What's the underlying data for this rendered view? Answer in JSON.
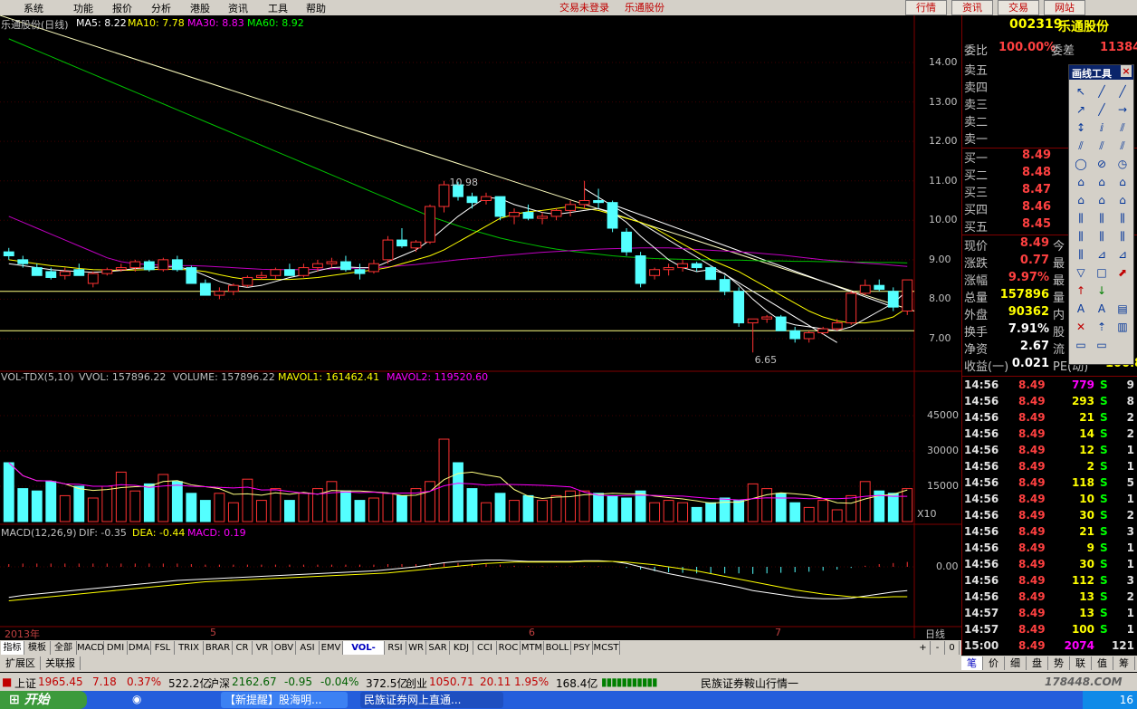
{
  "menu": [
    "系统",
    "功能",
    "报价",
    "分析",
    "港股",
    "资讯",
    "工具",
    "帮助"
  ],
  "menu_status": "交易未登录",
  "menu_stock": "乐通股份",
  "top_buttons": [
    "行情",
    "资讯",
    "交易",
    "网站"
  ],
  "stock": {
    "code": "002319",
    "name": "乐通股份"
  },
  "main_chart": {
    "title": "乐通股份(日线)",
    "ma_labels": [
      {
        "text": "MA5: 8.22",
        "color": "#ffffff"
      },
      {
        "text": "MA10: 7.78",
        "color": "#ffff00"
      },
      {
        "text": "MA30: 8.83",
        "color": "#ff00ff"
      },
      {
        "text": "MA60: 8.92",
        "color": "#00ff00"
      }
    ],
    "y_ticks": [
      "14.00",
      "13.00",
      "12.00",
      "11.00",
      "10.00",
      "9.00",
      "8.00",
      "7.00"
    ],
    "annotations": [
      "10.98",
      "6.65"
    ]
  },
  "vol_chart": {
    "labels": [
      {
        "text": "VOL-TDX(5,10)",
        "color": "#c0c0c0"
      },
      {
        "text": "VVOL: 157896.22",
        "color": "#c0c0c0"
      },
      {
        "text": "VOLUME: 157896.22",
        "color": "#c0c0c0"
      },
      {
        "text": "MAVOL1: 161462.41",
        "color": "#ffff00"
      },
      {
        "text": "MAVOL2: 119520.60",
        "color": "#ff00ff"
      }
    ],
    "y_ticks": [
      "45000",
      "30000",
      "15000"
    ],
    "unit_tag": "X10"
  },
  "macd_chart": {
    "labels": [
      {
        "text": "MACD(12,26,9)",
        "color": "#c0c0c0"
      },
      {
        "text": "DIF: -0.35",
        "color": "#c0c0c0"
      },
      {
        "text": "DEA: -0.44",
        "color": "#ffff00"
      },
      {
        "text": "MACD: 0.19",
        "color": "#ff00ff"
      }
    ],
    "y_tick": "0.00"
  },
  "x_axis": [
    "2013年",
    "5",
    "6",
    "7"
  ],
  "period": "日线",
  "chart_data": {
    "type": "candlestick",
    "candles": [
      [
        9.2,
        9.3,
        9.0,
        9.1
      ],
      [
        9.0,
        9.1,
        8.8,
        8.9
      ],
      [
        8.8,
        8.9,
        8.6,
        8.6
      ],
      [
        8.7,
        8.8,
        8.5,
        8.55
      ],
      [
        8.6,
        8.8,
        8.5,
        8.7
      ],
      [
        8.75,
        8.9,
        8.6,
        8.6
      ],
      [
        8.4,
        8.7,
        8.3,
        8.65
      ],
      [
        8.65,
        8.8,
        8.6,
        8.75
      ],
      [
        8.75,
        8.9,
        8.7,
        8.8
      ],
      [
        8.8,
        9.0,
        8.7,
        8.95
      ],
      [
        8.95,
        9.0,
        8.7,
        8.75
      ],
      [
        8.75,
        9.05,
        8.7,
        9.0
      ],
      [
        9.0,
        9.1,
        8.7,
        8.75
      ],
      [
        8.8,
        8.85,
        8.4,
        8.4
      ],
      [
        8.4,
        8.5,
        8.1,
        8.1
      ],
      [
        8.1,
        8.3,
        8.0,
        8.2
      ],
      [
        8.2,
        8.4,
        8.1,
        8.35
      ],
      [
        8.35,
        8.6,
        8.3,
        8.55
      ],
      [
        8.55,
        8.7,
        8.5,
        8.6
      ],
      [
        8.6,
        8.8,
        8.5,
        8.75
      ],
      [
        8.75,
        8.9,
        8.6,
        8.6
      ],
      [
        8.6,
        8.9,
        8.55,
        8.8
      ],
      [
        8.8,
        9.0,
        8.7,
        8.9
      ],
      [
        8.9,
        9.05,
        8.8,
        8.95
      ],
      [
        8.95,
        9.1,
        8.7,
        8.75
      ],
      [
        8.75,
        8.9,
        8.5,
        8.65
      ],
      [
        8.7,
        9.0,
        8.65,
        8.9
      ],
      [
        9.0,
        9.6,
        8.9,
        9.5
      ],
      [
        9.5,
        9.8,
        9.3,
        9.35
      ],
      [
        9.3,
        9.5,
        9.2,
        9.45
      ],
      [
        9.45,
        10.4,
        9.4,
        10.35
      ],
      [
        10.35,
        11.0,
        10.2,
        10.9
      ],
      [
        10.9,
        10.98,
        10.5,
        10.6
      ],
      [
        10.6,
        10.7,
        10.3,
        10.45
      ],
      [
        10.5,
        10.7,
        10.4,
        10.6
      ],
      [
        10.6,
        10.6,
        10.0,
        10.1
      ],
      [
        10.1,
        10.3,
        9.9,
        10.2
      ],
      [
        10.2,
        10.4,
        10.0,
        10.05
      ],
      [
        10.05,
        10.2,
        9.9,
        10.1
      ],
      [
        10.1,
        10.3,
        10.0,
        10.25
      ],
      [
        10.25,
        10.5,
        10.1,
        10.4
      ],
      [
        10.4,
        11.0,
        10.3,
        10.5
      ],
      [
        10.5,
        10.8,
        10.3,
        10.45
      ],
      [
        10.45,
        10.5,
        9.7,
        9.8
      ],
      [
        9.7,
        9.8,
        9.1,
        9.2
      ],
      [
        9.1,
        9.2,
        8.3,
        8.4
      ],
      [
        8.6,
        8.8,
        8.5,
        8.75
      ],
      [
        8.75,
        8.9,
        8.6,
        8.8
      ],
      [
        8.8,
        9.0,
        8.7,
        8.9
      ],
      [
        8.9,
        8.95,
        8.7,
        8.8
      ],
      [
        8.8,
        8.85,
        8.5,
        8.5
      ],
      [
        8.5,
        8.6,
        8.1,
        8.2
      ],
      [
        8.2,
        8.3,
        7.3,
        7.4
      ],
      [
        7.4,
        7.5,
        6.65,
        7.5
      ],
      [
        7.5,
        7.6,
        7.4,
        7.55
      ],
      [
        7.55,
        7.6,
        7.2,
        7.2
      ],
      [
        7.2,
        7.3,
        6.9,
        7.0
      ],
      [
        7.0,
        7.2,
        6.9,
        7.15
      ],
      [
        7.15,
        7.3,
        7.1,
        7.25
      ],
      [
        7.25,
        7.5,
        7.2,
        7.4
      ],
      [
        7.4,
        8.2,
        7.35,
        8.15
      ],
      [
        8.15,
        8.5,
        8.1,
        8.35
      ],
      [
        8.35,
        8.5,
        8.2,
        8.25
      ],
      [
        8.2,
        8.3,
        7.7,
        7.8
      ],
      [
        7.7,
        8.49,
        7.6,
        8.49
      ]
    ],
    "volumes": [
      25000,
      14000,
      13000,
      17000,
      11000,
      15000,
      10000,
      15000,
      21000,
      13000,
      16000,
      20000,
      17000,
      12000,
      9000,
      12000,
      8000,
      18000,
      9000,
      14000,
      9000,
      12000,
      14000,
      17000,
      13000,
      9000,
      10000,
      12000,
      11000,
      14000,
      17000,
      35000,
      25000,
      14000,
      8000,
      12000,
      9000,
      11000,
      9000,
      11000,
      13000,
      13000,
      12000,
      11000,
      10000,
      13000,
      8000,
      9000,
      8000,
      6000,
      8000,
      10000,
      9000,
      16000,
      14000,
      12000,
      8000,
      6000,
      9000,
      5000,
      11000,
      17000,
      13000,
      12000,
      14000
    ],
    "ma5": [
      8.9,
      8.85,
      8.8,
      8.75,
      8.72,
      8.7,
      8.68,
      8.7,
      8.73,
      8.78,
      8.8,
      8.82,
      8.82,
      8.75,
      8.6,
      8.45,
      8.35,
      8.3,
      8.35,
      8.45,
      8.55,
      8.62,
      8.72,
      8.8,
      8.82,
      8.8,
      8.8,
      8.95,
      9.1,
      9.25,
      9.5,
      9.8,
      10.1,
      10.35,
      10.58,
      10.55,
      10.4,
      10.3,
      10.2,
      10.15,
      10.2,
      10.25,
      10.3,
      10.2,
      9.95,
      9.6,
      9.3,
      9.0,
      8.8,
      8.7,
      8.75,
      8.65,
      8.35,
      8.0,
      7.7,
      7.45,
      7.35,
      7.3,
      7.25,
      7.2,
      7.3,
      7.5,
      7.7,
      7.9,
      8.22
    ],
    "ma10": [
      9.0,
      8.95,
      8.9,
      8.85,
      8.82,
      8.78,
      8.75,
      8.74,
      8.73,
      8.74,
      8.75,
      8.76,
      8.76,
      8.74,
      8.7,
      8.62,
      8.55,
      8.5,
      8.5,
      8.5,
      8.5,
      8.52,
      8.55,
      8.6,
      8.65,
      8.7,
      8.74,
      8.8,
      8.9,
      9.0,
      9.1,
      9.25,
      9.45,
      9.65,
      9.85,
      10.05,
      10.15,
      10.22,
      10.25,
      10.3,
      10.35,
      10.3,
      10.25,
      10.15,
      10.05,
      9.95,
      9.8,
      9.6,
      9.4,
      9.2,
      9.0,
      8.85,
      8.7,
      8.5,
      8.3,
      8.1,
      7.9,
      7.7,
      7.55,
      7.45,
      7.4,
      7.4,
      7.45,
      7.55,
      7.78
    ],
    "ma30": [
      10.1,
      9.95,
      9.8,
      9.65,
      9.5,
      9.35,
      9.2,
      9.05,
      8.95,
      8.9,
      8.88,
      8.86,
      8.85,
      8.85,
      8.84,
      8.82,
      8.8,
      8.78,
      8.76,
      8.75,
      8.75,
      8.75,
      8.76,
      8.77,
      8.78,
      8.79,
      8.8,
      8.82,
      8.85,
      8.88,
      8.92,
      8.96,
      9.0,
      9.03,
      9.06,
      9.1,
      9.13,
      9.16,
      9.19,
      9.21,
      9.23,
      9.25,
      9.27,
      9.28,
      9.29,
      9.3,
      9.3,
      9.3,
      9.28,
      9.26,
      9.24,
      9.22,
      9.2,
      9.18,
      9.15,
      9.12,
      9.08,
      9.04,
      9.0,
      8.97,
      8.94,
      8.91,
      8.89,
      8.86,
      8.83
    ],
    "ma60": [
      14.6,
      14.45,
      14.3,
      14.15,
      14.0,
      13.85,
      13.7,
      13.55,
      13.4,
      13.25,
      13.1,
      12.95,
      12.8,
      12.65,
      12.5,
      12.35,
      12.2,
      12.05,
      11.9,
      11.75,
      11.6,
      11.45,
      11.3,
      11.15,
      11.0,
      10.85,
      10.7,
      10.55,
      10.4,
      10.25,
      10.1,
      9.98,
      9.86,
      9.75,
      9.65,
      9.55,
      9.47,
      9.4,
      9.33,
      9.27,
      9.22,
      9.18,
      9.14,
      9.1,
      9.07,
      9.05,
      9.03,
      9.02,
      9.01,
      9.0,
      9.0,
      8.99,
      8.99,
      8.98,
      8.97,
      8.97,
      8.96,
      8.96,
      8.95,
      8.95,
      8.94,
      8.94,
      8.93,
      8.93,
      8.92
    ],
    "macd_dif": [
      -0.45,
      -0.42,
      -0.4,
      -0.38,
      -0.36,
      -0.34,
      -0.32,
      -0.3,
      -0.28,
      -0.26,
      -0.24,
      -0.22,
      -0.2,
      -0.19,
      -0.18,
      -0.17,
      -0.16,
      -0.15,
      -0.14,
      -0.13,
      -0.12,
      -0.11,
      -0.1,
      -0.09,
      -0.08,
      -0.07,
      -0.06,
      -0.04,
      -0.02,
      0.0,
      0.03,
      0.06,
      0.08,
      0.09,
      0.1,
      0.1,
      0.09,
      0.08,
      0.08,
      0.08,
      0.08,
      0.09,
      0.09,
      0.08,
      0.05,
      0.0,
      -0.05,
      -0.1,
      -0.14,
      -0.18,
      -0.22,
      -0.26,
      -0.3,
      -0.35,
      -0.38,
      -0.41,
      -0.44,
      -0.46,
      -0.47,
      -0.47,
      -0.46,
      -0.43,
      -0.4,
      -0.37,
      -0.35
    ],
    "macd_dea": [
      -0.5,
      -0.48,
      -0.46,
      -0.44,
      -0.42,
      -0.4,
      -0.38,
      -0.36,
      -0.34,
      -0.32,
      -0.3,
      -0.28,
      -0.26,
      -0.24,
      -0.22,
      -0.21,
      -0.2,
      -0.19,
      -0.18,
      -0.17,
      -0.16,
      -0.15,
      -0.14,
      -0.13,
      -0.12,
      -0.11,
      -0.1,
      -0.09,
      -0.07,
      -0.05,
      -0.03,
      -0.01,
      0.01,
      0.03,
      0.05,
      0.06,
      0.07,
      0.07,
      0.07,
      0.07,
      0.07,
      0.08,
      0.08,
      0.08,
      0.07,
      0.05,
      0.03,
      0.0,
      -0.03,
      -0.06,
      -0.1,
      -0.14,
      -0.18,
      -0.22,
      -0.26,
      -0.3,
      -0.34,
      -0.37,
      -0.4,
      -0.42,
      -0.44,
      -0.45,
      -0.45,
      -0.44,
      -0.44
    ]
  },
  "order_book": {
    "wb_label": "委比",
    "wb_value": "100.00%",
    "wc_label": "委差",
    "wc_value": "11384",
    "sell": [
      {
        "label": "卖五",
        "price": ""
      },
      {
        "label": "卖四",
        "price": ""
      },
      {
        "label": "卖三",
        "price": ""
      },
      {
        "label": "卖二",
        "price": ""
      },
      {
        "label": "卖一",
        "price": ""
      }
    ],
    "buy": [
      {
        "label": "买一",
        "price": "8.49"
      },
      {
        "label": "买二",
        "price": "8.48"
      },
      {
        "label": "买三",
        "price": "8.47"
      },
      {
        "label": "买四",
        "price": "8.46"
      },
      {
        "label": "买五",
        "price": "8.45"
      }
    ]
  },
  "quote": [
    {
      "label": "现价",
      "value": "8.49",
      "right": "今"
    },
    {
      "label": "涨跌",
      "value": "0.77",
      "right": "最"
    },
    {
      "label": "涨幅",
      "value": "9.97%",
      "right": "最"
    },
    {
      "label": "总量",
      "value": "157896",
      "right": "量"
    },
    {
      "label": "外盘",
      "value": "90362",
      "right": "内"
    },
    {
      "label": "换手",
      "value": "7.91%",
      "right": "股"
    },
    {
      "label": "净资",
      "value": "2.67",
      "right": "流"
    },
    {
      "label": "收益(一)",
      "value": "0.021",
      "right": "PE(动)",
      "extra": "100.8"
    }
  ],
  "ticks": [
    {
      "time": "14:56",
      "price": "8.49",
      "vol": "779",
      "dir": "S",
      "n": "9"
    },
    {
      "time": "14:56",
      "price": "8.49",
      "vol": "293",
      "dir": "S",
      "n": "8"
    },
    {
      "time": "14:56",
      "price": "8.49",
      "vol": "21",
      "dir": "S",
      "n": "2"
    },
    {
      "time": "14:56",
      "price": "8.49",
      "vol": "14",
      "dir": "S",
      "n": "2"
    },
    {
      "time": "14:56",
      "price": "8.49",
      "vol": "12",
      "dir": "S",
      "n": "1"
    },
    {
      "time": "14:56",
      "price": "8.49",
      "vol": "2",
      "dir": "S",
      "n": "1"
    },
    {
      "time": "14:56",
      "price": "8.49",
      "vol": "118",
      "dir": "S",
      "n": "5"
    },
    {
      "time": "14:56",
      "price": "8.49",
      "vol": "10",
      "dir": "S",
      "n": "1"
    },
    {
      "time": "14:56",
      "price": "8.49",
      "vol": "30",
      "dir": "S",
      "n": "2"
    },
    {
      "time": "14:56",
      "price": "8.49",
      "vol": "21",
      "dir": "S",
      "n": "3"
    },
    {
      "time": "14:56",
      "price": "8.49",
      "vol": "9",
      "dir": "S",
      "n": "1"
    },
    {
      "time": "14:56",
      "price": "8.49",
      "vol": "30",
      "dir": "S",
      "n": "1"
    },
    {
      "time": "14:56",
      "price": "8.49",
      "vol": "112",
      "dir": "S",
      "n": "3"
    },
    {
      "time": "14:56",
      "price": "8.49",
      "vol": "13",
      "dir": "S",
      "n": "2"
    },
    {
      "time": "14:57",
      "price": "8.49",
      "vol": "13",
      "dir": "S",
      "n": "1"
    },
    {
      "time": "14:57",
      "price": "8.49",
      "vol": "100",
      "dir": "S",
      "n": "1"
    },
    {
      "time": "15:00",
      "price": "8.49",
      "vol": "2074",
      "dir": "",
      "n": "121"
    }
  ],
  "drawtool": {
    "title": "画线工具",
    "close": "×"
  },
  "indicator_tabs": [
    "指标",
    "模板",
    "全部",
    "MACD",
    "DMI",
    "DMA",
    "FSL",
    "TRIX",
    "BRAR",
    "CR",
    "VR",
    "OBV",
    "ASI",
    "EMV",
    "VOL-TDX",
    "RSI",
    "WR",
    "SAR",
    "KDJ",
    "CCI",
    "ROC",
    "MTM",
    "BOLL",
    "PSY",
    "MCST"
  ],
  "zoom_controls": [
    "+",
    "-",
    "0"
  ],
  "bottom_tabs": [
    "扩展区",
    "关联报价"
  ],
  "right_tabs": [
    "笔",
    "价",
    "细",
    "盘",
    "势",
    "联",
    "值",
    "筹"
  ],
  "status": {
    "sh_label": "上证",
    "sh_val": "1965.45",
    "sh_chg": "7.18",
    "sh_pct": "0.37%",
    "sh_amt": "522.2亿",
    "hs_label": "沪深",
    "hs_val": "2162.67",
    "hs_chg": "-0.95",
    "hs_pct": "-0.04%",
    "hs_amt": "372.5亿",
    "cy_label": "创业",
    "cy_val": "1050.71",
    "cy_chg": "20.11",
    "cy_pct": "1.95%",
    "cy_amt": "168.4亿",
    "broker": "民族证券鞍山行情一",
    "watermark": "178448.COM"
  },
  "taskbar": {
    "start": "开始",
    "items": [
      "【新提醒】股海明...",
      "民族证券网上直通..."
    ],
    "clock": "16"
  }
}
